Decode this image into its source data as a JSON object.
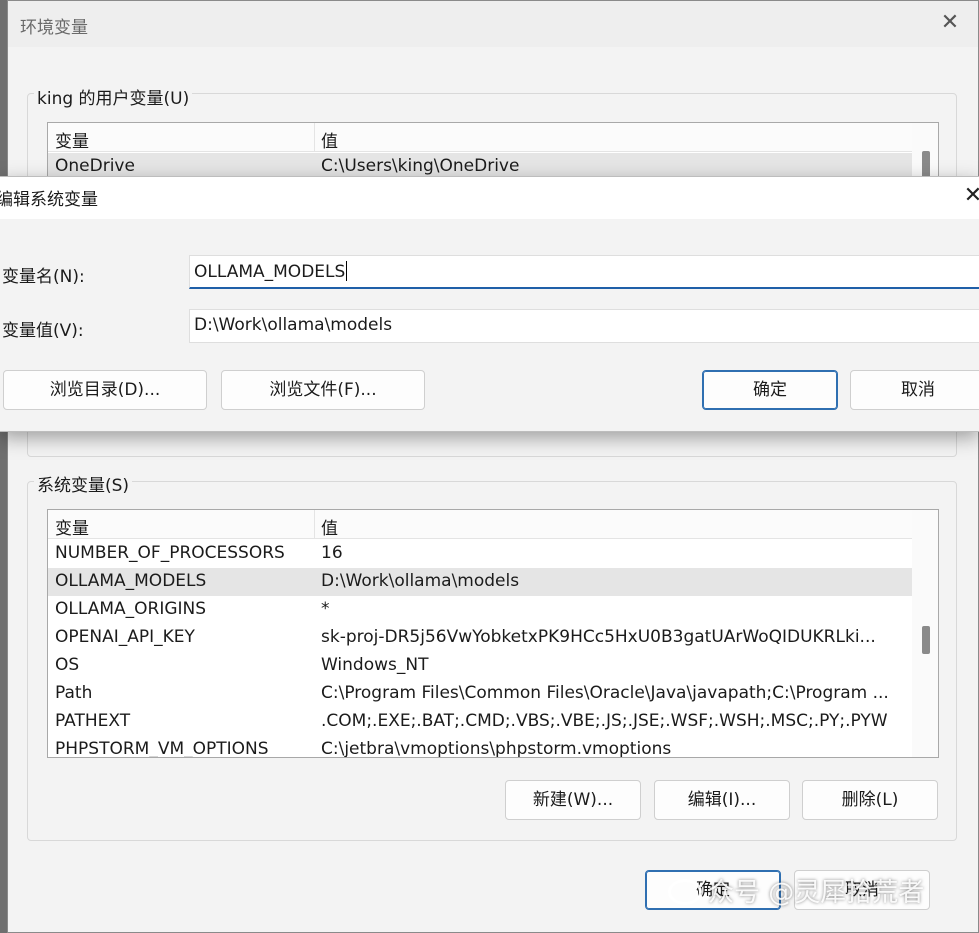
{
  "env_dialog": {
    "title": "环境变量",
    "close_glyph": "✕",
    "user_vars": {
      "label": "king 的用户变量(U)",
      "col_name": "变量",
      "col_value": "值",
      "rows": [
        {
          "name": "OneDrive",
          "value": "C:\\Users\\king\\OneDrive"
        }
      ]
    },
    "system_vars": {
      "label": "系统变量(S)",
      "col_name": "变量",
      "col_value": "值",
      "rows": [
        {
          "name": "NUMBER_OF_PROCESSORS",
          "value": "16"
        },
        {
          "name": "OLLAMA_MODELS",
          "value": "D:\\Work\\ollama\\models"
        },
        {
          "name": "OLLAMA_ORIGINS",
          "value": "*"
        },
        {
          "name": "OPENAI_API_KEY",
          "value": "sk-proj-DR5j56VwYobketxPK9HCc5HxU0B3gatUArWoQIDUKRLki..."
        },
        {
          "name": "OS",
          "value": "Windows_NT"
        },
        {
          "name": "Path",
          "value": "C:\\Program Files\\Common Files\\Oracle\\Java\\javapath;C:\\Program ..."
        },
        {
          "name": "PATHEXT",
          "value": ".COM;.EXE;.BAT;.CMD;.VBS;.VBE;.JS;.JSE;.WSF;.WSH;.MSC;.PY;.PYW"
        },
        {
          "name": "PHPSTORM_VM_OPTIONS",
          "value": "C:\\jetbra\\vmoptions\\phpstorm.vmoptions"
        }
      ],
      "selected_index": 1
    },
    "buttons": {
      "new": "新建(W)...",
      "edit": "编辑(I)...",
      "delete": "删除(L)",
      "ok": "确定",
      "cancel": "取消"
    }
  },
  "edit_dialog": {
    "title": "编辑系统变量",
    "close_glyph": "✕",
    "name_label": "变量名(N):",
    "name_value": "OLLAMA_MODELS",
    "value_label": "变量值(V):",
    "value_value": "D:\\Work\\ollama\\models",
    "buttons": {
      "browse_dir": "浏览目录(D)...",
      "browse_file": "浏览文件(F)...",
      "ok": "确定",
      "cancel": "取消"
    }
  },
  "watermark": "众号 @灵犀拾荒者"
}
